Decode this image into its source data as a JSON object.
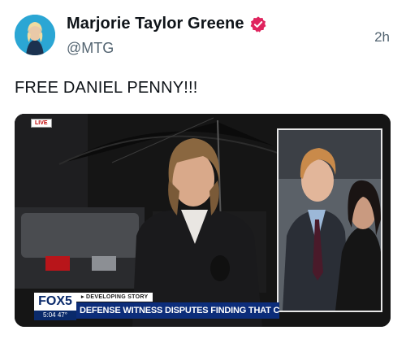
{
  "author": {
    "name": "Marjorie Taylor Greene",
    "handle": "@MTG",
    "verified_color": "#e0245e"
  },
  "post": {
    "time": "2h",
    "text": "FREE DANIEL PENNY!!!"
  },
  "media": {
    "live_label": "LIVE",
    "channel_logo": "FOX5",
    "clock": "5:04  47°",
    "banner_tag": "▸ DEVELOPING STORY",
    "headline": "DEFENSE WITNESS DISPUTES FINDING THAT CHOKEHOLD CAU"
  }
}
